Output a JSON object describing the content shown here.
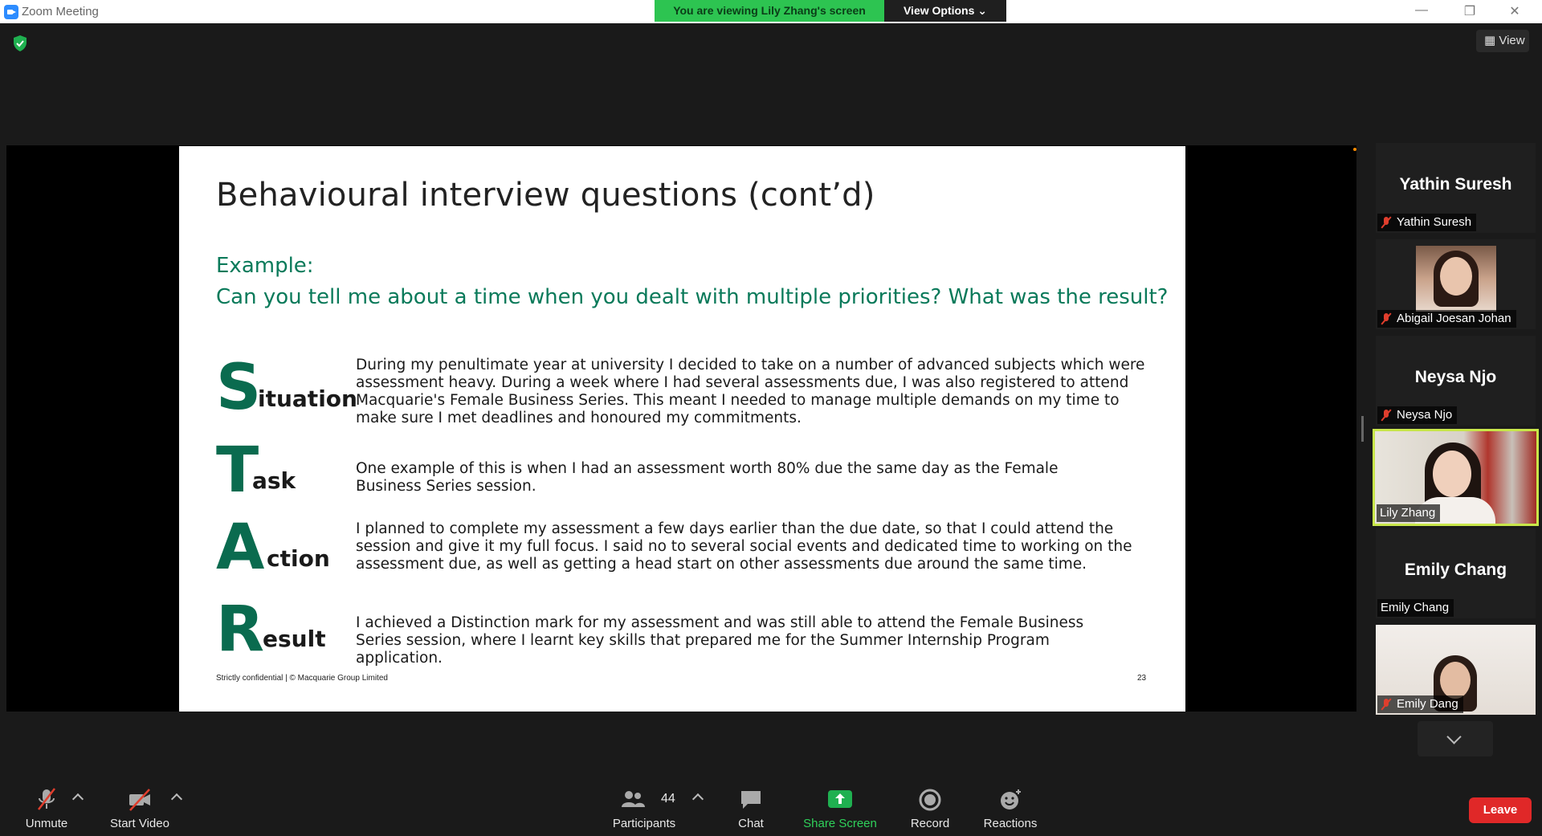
{
  "window": {
    "title": "Zoom Meeting",
    "viewing_banner": "You are viewing Lily Zhang's screen",
    "view_options": "View Options",
    "view_button": "View"
  },
  "slide": {
    "title": "Behavioural interview questions (cont’d)",
    "example_label": "Example:",
    "question": "Can you tell me about a time when you dealt with multiple priorities? What was the result?",
    "star": [
      {
        "letter": "S",
        "rest": "ituation",
        "text": "During my penultimate year at university I decided to take on a number of advanced subjects which were assessment heavy. During a week where I had several assessments due, I was also registered to attend Macquarie's Female Business Series. This meant I needed to manage multiple demands on my time to make sure I met deadlines and honoured my commitments."
      },
      {
        "letter": "T",
        "rest": "ask",
        "text": "One example of this is when I had an assessment worth 80% due the same day as the Female Business Series session."
      },
      {
        "letter": "A",
        "rest": "ction",
        "text": "I planned to complete my assessment a few days earlier than the due date, so that I could attend the session and give it my full focus. I said no to several social events and dedicated time to working on the assessment due, as well as getting a head start on other assessments due around the same time."
      },
      {
        "letter": "R",
        "rest": "esult",
        "text": "I achieved a Distinction mark for my assessment and was still able to attend the Female Business Series session, where I learnt key skills that prepared me for the Summer Internship Program application."
      }
    ],
    "footer": "Strictly confidential | © Macquarie Group Limited",
    "page_number": "23"
  },
  "participants": [
    {
      "display_name": "Yathin Suresh",
      "tag": "Yathin Suresh",
      "muted": true,
      "video": false
    },
    {
      "display_name": "",
      "tag": "Abigail Joesan Johan",
      "muted": true,
      "video": true
    },
    {
      "display_name": "Neysa Njo",
      "tag": "Neysa Njo",
      "muted": true,
      "video": false
    },
    {
      "display_name": "",
      "tag": "Lily Zhang",
      "muted": false,
      "video": true,
      "active_speaker": true
    },
    {
      "display_name": "Emily Chang",
      "tag": "Emily Chang",
      "muted": false,
      "video": false
    },
    {
      "display_name": "",
      "tag": "Emily Dang",
      "muted": true,
      "video": true
    }
  ],
  "toolbar": {
    "unmute": "Unmute",
    "start_video": "Start Video",
    "participants": "Participants",
    "participants_count": "44",
    "chat": "Chat",
    "share_screen": "Share Screen",
    "record": "Record",
    "reactions": "Reactions",
    "leave": "Leave"
  },
  "colors": {
    "accent_green": "#0a6b4f",
    "banner_green": "#2dc451",
    "leave_red": "#e02828",
    "active_border": "#c8e64a"
  }
}
